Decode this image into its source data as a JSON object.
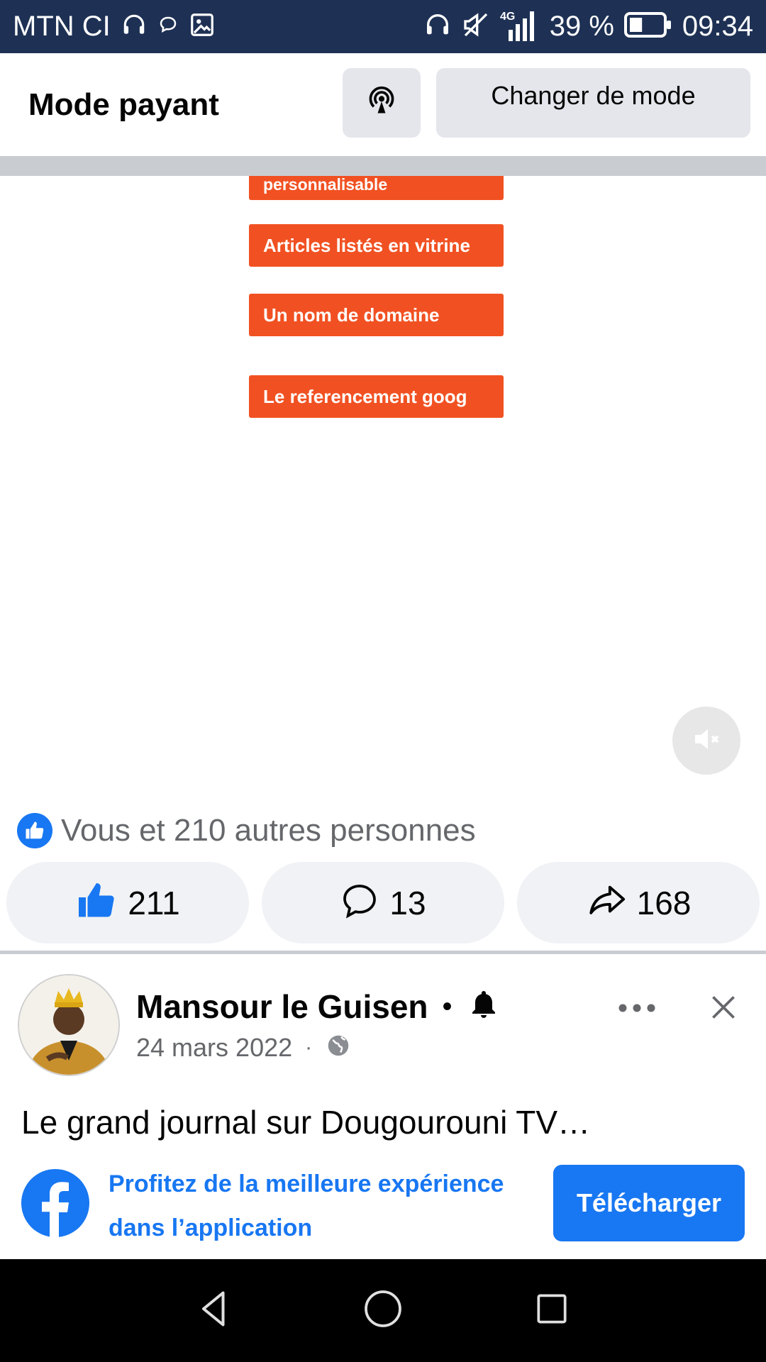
{
  "status_bar": {
    "carrier": "MTN CI",
    "network": "4G",
    "battery": "39 %",
    "battery_level": 0.39,
    "time": "09:34"
  },
  "header": {
    "title": "Mode payant",
    "switch_label": "Changer de mode"
  },
  "video": {
    "tags": [
      "personnalisable",
      "Articles listés en vitrine",
      "Un nom de domaine",
      "Le referencement goog"
    ]
  },
  "reactions": {
    "summary": "Vous et 210 autres personnes",
    "like_count": "211",
    "comment_count": "13",
    "share_count": "168"
  },
  "post": {
    "author": "Mansour le Guisen",
    "separator": "•",
    "date": "24 mars 2022",
    "meta_separator": "·",
    "text": "Le grand journal sur Dougourouni TV…"
  },
  "app_banner": {
    "message": "Profitez de la meilleure expérience dans l’application",
    "button": "Télécharger"
  },
  "colors": {
    "status_bar": "#1e3154",
    "facebook_blue": "#1877f2",
    "tag_orange": "#f15122",
    "pill_gray": "#f0f2f5"
  }
}
